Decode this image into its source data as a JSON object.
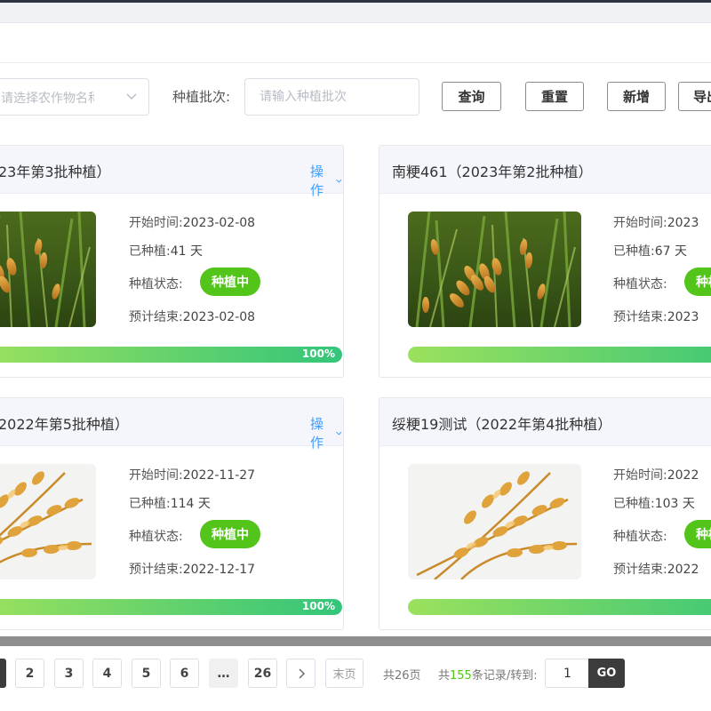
{
  "filters": {
    "crop_placeholder": "请选择农作物名称",
    "batch_label": "种植批次:",
    "batch_placeholder": "请输入种植批次",
    "buttons": {
      "query": "查询",
      "reset": "重置",
      "add": "新增",
      "export": "导出"
    }
  },
  "cards": [
    {
      "title": "…23年第3批种植）",
      "action": "操作",
      "start_label": "开始时间:",
      "start": "2023-02-08",
      "planted_label": "已种植:",
      "planted": "41 天",
      "status_label": "种植状态:",
      "status": "种植中",
      "end_label": "预计结束:",
      "end": "2023-02-08",
      "progress": 100,
      "progress_text": "100%",
      "image": "rice-field-photo"
    },
    {
      "title": "南粳461（2023年第2批种植）",
      "action": "操作",
      "start_label": "开始时间:",
      "start": "2023",
      "planted_label": "已种植:",
      "planted": "67 天",
      "status_label": "种植状态:",
      "status": "种植中",
      "end_label": "预计结束:",
      "end": "2023",
      "progress": 100,
      "progress_text": "100%",
      "image": "rice-field-photo"
    },
    {
      "title": "…2022年第5批种植）",
      "action": "操作",
      "start_label": "开始时间:",
      "start": "2022-11-27",
      "planted_label": "已种植:",
      "planted": "114 天",
      "status_label": "种植状态:",
      "status": "种植中",
      "end_label": "预计结束:",
      "end": "2022-12-17",
      "progress": 100,
      "progress_text": "100%",
      "image": "wheat-ears-illustration"
    },
    {
      "title": "绥粳19测试（2022年第4批种植）",
      "action": "操作",
      "start_label": "开始时间:",
      "start": "2022",
      "planted_label": "已种植:",
      "planted": "103 天",
      "status_label": "种植状态:",
      "status": "种植中",
      "end_label": "预计结束:",
      "end": "2022",
      "progress": 100,
      "progress_text": "100%",
      "image": "wheat-ears-illustration"
    }
  ],
  "pagination": {
    "pages": [
      "2",
      "3",
      "4",
      "5",
      "6",
      "…",
      "26"
    ],
    "last": "末页",
    "total_pages": "共26页",
    "records_prefix": "共",
    "records_count": "155",
    "records_suffix": "条记录/转到:",
    "jump_value": "1",
    "go": "GO"
  },
  "colors": {
    "accent": "#409eff",
    "status_green": "#52c41a",
    "progress_start": "#9be15d",
    "progress_end": "#33c57a",
    "dark": "#3c3c3c"
  }
}
